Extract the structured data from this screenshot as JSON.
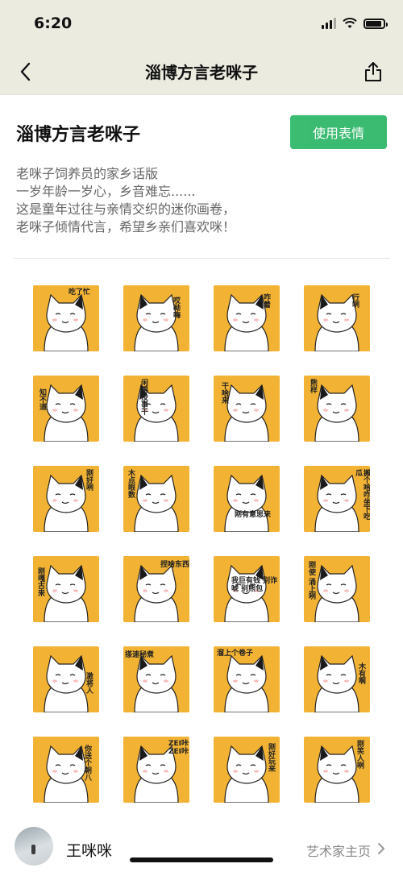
{
  "status_bar": {
    "time": "6:20",
    "battery_level": 0.9
  },
  "nav": {
    "title": "淄博方言老咪子",
    "back_icon": "chevron-left-icon",
    "share_icon": "share-icon"
  },
  "pack": {
    "title": "淄博方言老咪子",
    "use_button": "使用表情",
    "description": [
      "老咪子饲养员的家乡话版",
      "一岁年龄一岁心，乡音难忘......",
      "这是童年过往与亲情交织的迷你画卷，",
      "老咪子倾情代言，希望乡亲们喜欢咪！"
    ]
  },
  "stickers": [
    {
      "caption": "吃了忙"
    },
    {
      "caption": "哎呦嗨"
    },
    {
      "caption": "咋着"
    },
    {
      "caption": "行咧"
    },
    {
      "caption": "知不道"
    },
    {
      "caption": "闲得没事干"
    },
    {
      "caption": "干啥来"
    },
    {
      "caption": "熊样"
    },
    {
      "caption": "刚好咧"
    },
    {
      "caption": "木点眼数"
    },
    {
      "caption": "刚有意思来"
    },
    {
      "caption": "搬个啥咋坐下吃瓜"
    },
    {
      "caption": "刚嘎古来"
    },
    {
      "caption": "捏啥东西"
    },
    {
      "caption": "我巨有钱 别诈唬 别熊包"
    },
    {
      "caption": "刚使 涌上咧"
    },
    {
      "caption": "激将人"
    },
    {
      "caption": "搽速秘煮"
    },
    {
      "caption": "溜上个卷子"
    },
    {
      "caption": "木有啊"
    },
    {
      "caption": "你送个朝八"
    },
    {
      "caption": "ZEI咔 ZEI咔"
    },
    {
      "caption": "刚好玩来"
    },
    {
      "caption": "刚笑人咧"
    }
  ],
  "artist": {
    "name": "王咪咪",
    "link": "艺术家主页"
  },
  "colors": {
    "accent": "#1bb15a",
    "sticker_bg": "#f2b335",
    "nav_bg": "#ecebe0"
  }
}
